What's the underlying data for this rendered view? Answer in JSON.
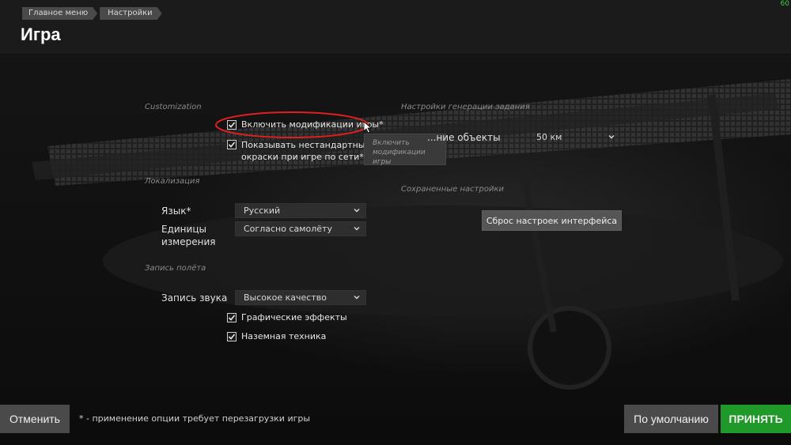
{
  "header": {
    "breadcrumb": [
      "Главное меню",
      "Настройки"
    ],
    "title": "Игра",
    "fps": "60"
  },
  "customization": {
    "section_title": "Customization",
    "enable_mods": {
      "label": "Включить модификации игры*",
      "checked": true
    },
    "show_skins": {
      "label_line1": "Показывать нестандартные схе",
      "label_line2": "окраски при игре по сети*",
      "checked": true
    },
    "tooltip_line1": "Включить",
    "tooltip_line2": "модификации игры"
  },
  "localization": {
    "section_title": "Локализация",
    "language_label": "Язык*",
    "language_value": "Русский",
    "units_label_line1": "Единицы",
    "units_label_line2": "измерения",
    "units_value": "Согласно самолёту"
  },
  "flight_record": {
    "section_title": "Запись полёта",
    "sound_label": "Запись звука",
    "sound_value": "Высокое качество",
    "graphic_effects": {
      "label": "Графические эффекты",
      "checked": true
    },
    "ground_vehicles": {
      "label": "Наземная техника",
      "checked": true
    }
  },
  "mission_generation": {
    "section_title": "Настройки генерации задания",
    "objects_label": "...ние объекты",
    "objects_value": "50 км"
  },
  "saved_settings": {
    "section_title": "Сохраненные настройки",
    "reset_button": "Сброс настроек интерфейса"
  },
  "footer": {
    "cancel": "Отменить",
    "note": "* - применение опции требует перезагрузки игры",
    "default": "По умолчанию",
    "accept": "ПРИНЯТЬ"
  },
  "colors": {
    "accent_green": "#1f9a2a",
    "highlight_red": "#e02020"
  }
}
